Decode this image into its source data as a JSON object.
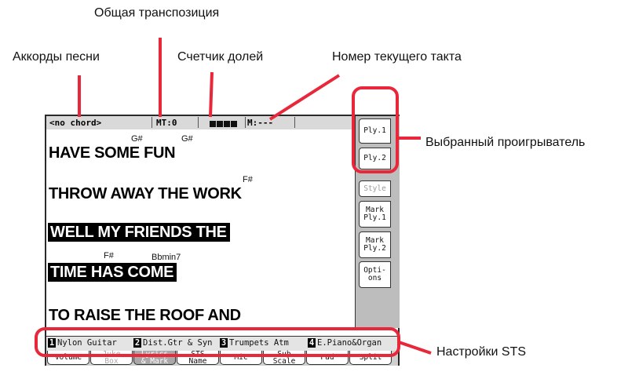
{
  "callouts": {
    "general_transposition": "Общая транспозиция",
    "song_chords": "Аккорды песни",
    "beat_counter": "Счетчик долей",
    "current_measure": "Номер текущего такта",
    "selected_player": "Выбранный проигрыватель",
    "sts_settings": "Настройки STS"
  },
  "status": {
    "chord": "<no chord>",
    "transpose": "MT:0",
    "measure": "M:---"
  },
  "lyrics": {
    "chords": [
      "G#",
      "G#",
      "F#",
      "F#",
      "Bbmin7"
    ],
    "lines": [
      "HAVE SOME FUN",
      "THROW AWAY THE WORK",
      "WELL MY FRIENDS THE",
      "TIME HAS COME",
      "TO RAISE THE ROOF AND"
    ]
  },
  "side_tabs": [
    "Ply.1",
    "Ply.2",
    "Style",
    "Mark\nPly.1",
    "Mark\nPly.2",
    "Opti-\nons"
  ],
  "sts": [
    {
      "num": "1",
      "name": "Nylon Guitar"
    },
    {
      "num": "2",
      "name": "Dist.Gtr & Syn"
    },
    {
      "num": "3",
      "name": "Trumpets Atm"
    },
    {
      "num": "4",
      "name": "E.Piano&Organ"
    }
  ],
  "bottom_tabs": [
    "Volume",
    "Juke\nBox",
    "Lyrics\n& Mark",
    "STS\nName",
    "Mic",
    "Sub\nScale",
    "Pad",
    "Split"
  ],
  "colors": {
    "callout_accent": "#e8283a",
    "highlight": "#000000"
  }
}
